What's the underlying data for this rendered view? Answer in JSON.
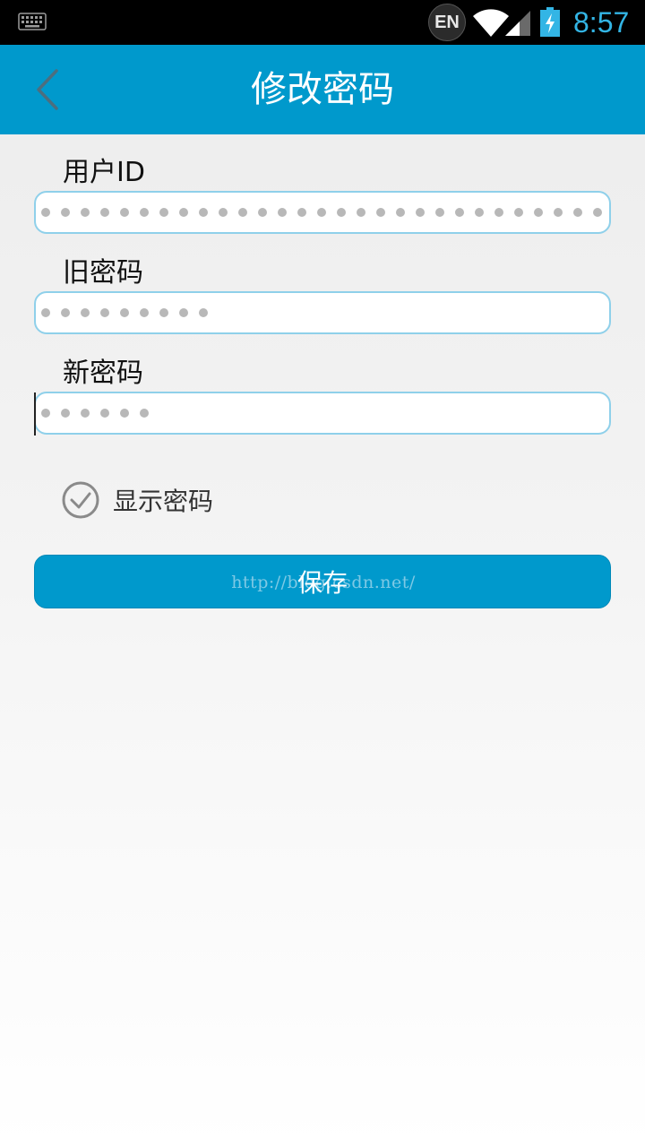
{
  "status_bar": {
    "keyboard_icon": "keyboard-icon",
    "ime_badge": "EN",
    "wifi_icon": "wifi-icon",
    "signal_icon": "signal-icon",
    "battery_icon": "battery-charging-icon",
    "time": "8:57",
    "clock_color": "#33b5e5"
  },
  "app_bar": {
    "title": "修改密码",
    "back_icon": "chevron-left-icon",
    "color": "#0099cc"
  },
  "form": {
    "user_id": {
      "label": "用户ID",
      "masked_length": 29
    },
    "old_password": {
      "label": "旧密码",
      "masked_length": 9
    },
    "new_password": {
      "label": "新密码",
      "masked_length": 6
    }
  },
  "show_password": {
    "label": "显示密码",
    "icon": "check-circle-icon",
    "checked": true
  },
  "save_button": {
    "label": "保存",
    "watermark": "http://blog.csdn.net/"
  }
}
